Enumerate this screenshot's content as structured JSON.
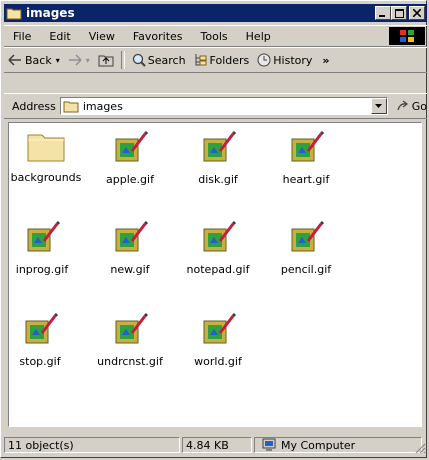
{
  "window": {
    "title": "images"
  },
  "menu": {
    "file": "File",
    "edit": "Edit",
    "view": "View",
    "favorites": "Favorites",
    "tools": "Tools",
    "help": "Help"
  },
  "toolbar": {
    "back": "Back",
    "search": "Search",
    "folders": "Folders",
    "history": "History",
    "more": "»"
  },
  "address": {
    "label": "Address",
    "value": "images",
    "go": "Go"
  },
  "files": [
    {
      "name": "backgrounds",
      "type": "folder"
    },
    {
      "name": "apple.gif",
      "type": "gif"
    },
    {
      "name": "disk.gif",
      "type": "gif"
    },
    {
      "name": "heart.gif",
      "type": "gif"
    },
    {
      "name": "inprog.gif",
      "type": "gif"
    },
    {
      "name": "new.gif",
      "type": "gif"
    },
    {
      "name": "notepad.gif",
      "type": "gif"
    },
    {
      "name": "pencil.gif",
      "type": "gif"
    },
    {
      "name": "stop.gif",
      "type": "gif"
    },
    {
      "name": "undrcnst.gif",
      "type": "gif"
    },
    {
      "name": "world.gif",
      "type": "gif"
    }
  ],
  "status": {
    "objects": "11 object(s)",
    "size": "4.84 KB",
    "location": "My Computer"
  },
  "colors": {
    "titlebar": "#0a246a",
    "chrome": "#d4d0c8",
    "folder": "#f4e3a6"
  }
}
